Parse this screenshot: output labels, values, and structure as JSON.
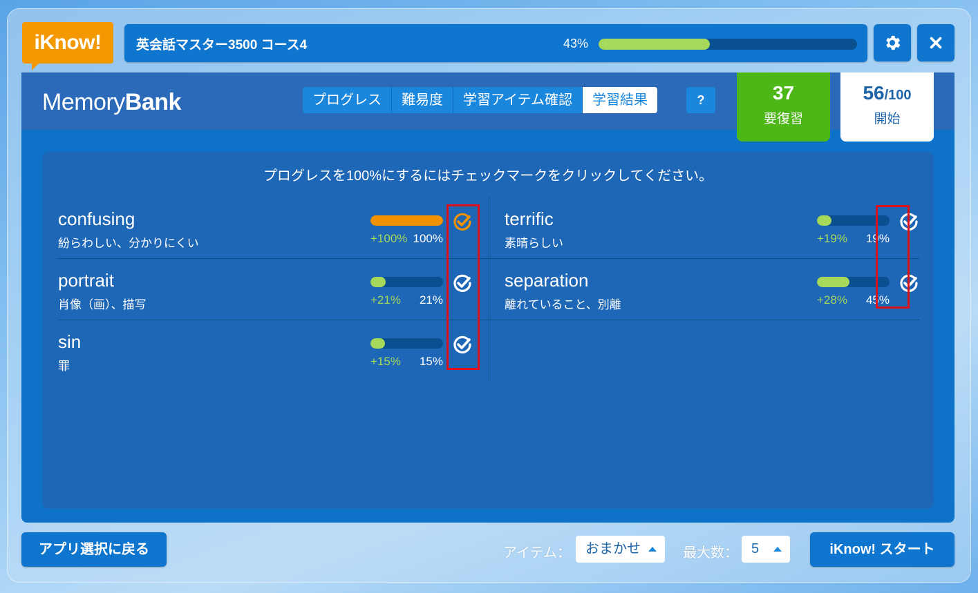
{
  "app": {
    "logo": "iKnow!"
  },
  "header": {
    "course_title": "英会話マスター3500 コース4",
    "progress_label": "43%",
    "progress": 0.43
  },
  "memorybank": {
    "title_light": "Memory",
    "title_bold": "Bank",
    "tabs": [
      {
        "label": "プログレス",
        "active": false
      },
      {
        "label": "難易度",
        "active": false
      },
      {
        "label": "学習アイテム確認",
        "active": false
      },
      {
        "label": "学習結果",
        "active": true
      }
    ],
    "help_label": "?",
    "review": {
      "count": "37",
      "label": "要復習"
    },
    "start": {
      "count": "56",
      "total": "/100",
      "label": "開始"
    }
  },
  "instruction": "プログレスを100%にするにはチェックマークをクリックしてください。",
  "items": [
    {
      "word": "confusing",
      "meaning": "紛らわしい、分かりにくい",
      "delta": "+100%",
      "pct": "100%",
      "progress": 1.0,
      "check_color": "#f39200"
    },
    {
      "word": "terrific",
      "meaning": "素晴らしい",
      "delta": "+19%",
      "pct": "19%",
      "progress": 0.19,
      "check_color": "#ffffff"
    },
    {
      "word": "portrait",
      "meaning": "肖像（画）、描写",
      "delta": "+21%",
      "pct": "21%",
      "progress": 0.21,
      "check_color": "#ffffff"
    },
    {
      "word": "separation",
      "meaning": "離れていること、別離",
      "delta": "+28%",
      "pct": "45%",
      "progress": 0.45,
      "check_color": "#ffffff"
    },
    {
      "word": "sin",
      "meaning": "罪",
      "delta": "+15%",
      "pct": "15%",
      "progress": 0.15,
      "check_color": "#ffffff"
    }
  ],
  "footer": {
    "back_label": "アプリ選択に戻る",
    "item_label": "アイテム：",
    "item_value": "おまかせ",
    "max_label": "最大数：",
    "max_value": "5",
    "start_label": "iKnow! スタート"
  },
  "colors": {
    "accent": "#0f76cf",
    "orange": "#f39800",
    "green": "#4cb717",
    "bar_fill": "#a6d85c"
  }
}
